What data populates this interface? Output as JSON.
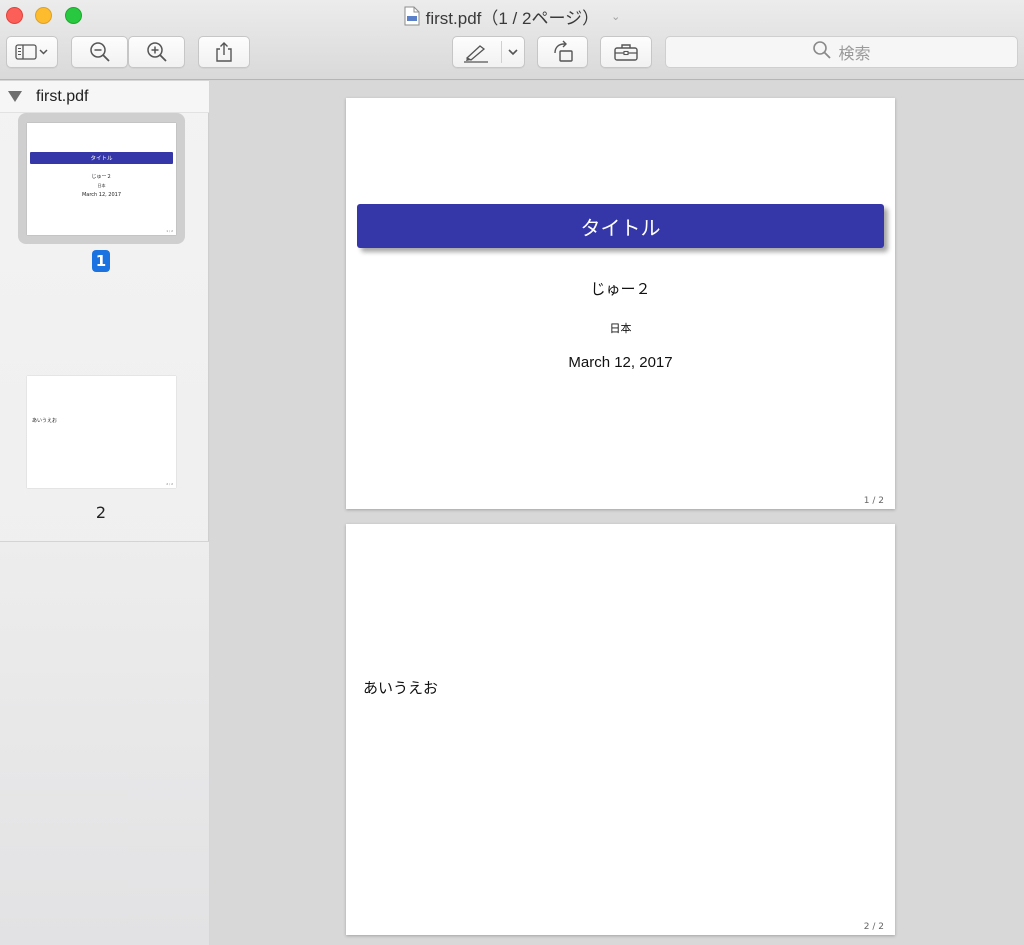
{
  "window": {
    "title": "first.pdf（1 / 2ページ）"
  },
  "toolbar": {
    "search_placeholder": "検索"
  },
  "sidebar": {
    "file_name": "first.pdf",
    "thumbnails": [
      {
        "label": "1",
        "selected": true
      },
      {
        "label": "2",
        "selected": false
      }
    ]
  },
  "document": {
    "pages": [
      {
        "title": "タイトル",
        "author": "じゅー２",
        "institute": "日本",
        "date": "March 12, 2017",
        "page_number": "1 / 2"
      },
      {
        "body": "あいうえお",
        "page_number": "2 / 2"
      }
    ]
  },
  "colors": {
    "title_block": "#3537a8",
    "selected_badge": "#1a73e0",
    "close": "#fc5f57",
    "minimize": "#fdbc2e",
    "maximize": "#28c840"
  }
}
